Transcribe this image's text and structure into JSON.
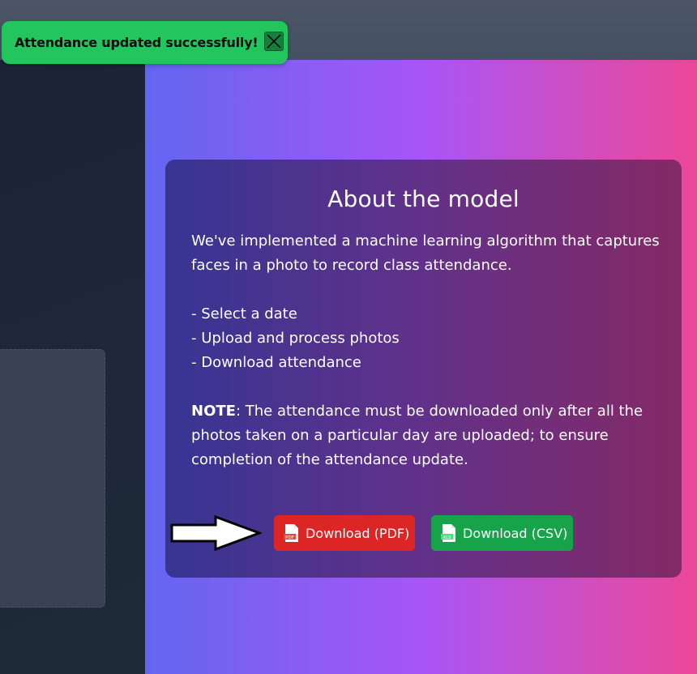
{
  "toast": {
    "message": "Attendance updated successfully!",
    "close_icon": "close-icon"
  },
  "about": {
    "title": "About the model",
    "intro": "We've implemented a machine learning algorithm that captures faces in a photo to record class attendance.",
    "steps": [
      "- Select a date",
      "- Upload and process photos",
      "- Download attendance"
    ],
    "note_label": "NOTE",
    "note_text": ": The attendance must be downloaded only after all the photos taken on a particular day are uploaded; to ensure completion of the attendance update."
  },
  "downloads": {
    "pdf_label": "Download (PDF)",
    "pdf_icon_text": "PDF",
    "csv_label": "Download (CSV)",
    "csv_icon_text": "XLS"
  },
  "colors": {
    "toast_bg": "#22c55e",
    "pdf_button": "#dc2626",
    "csv_button": "#16a34a",
    "gradient_start": "#6366f1",
    "gradient_mid": "#a855f7",
    "gradient_end": "#ec4899"
  }
}
